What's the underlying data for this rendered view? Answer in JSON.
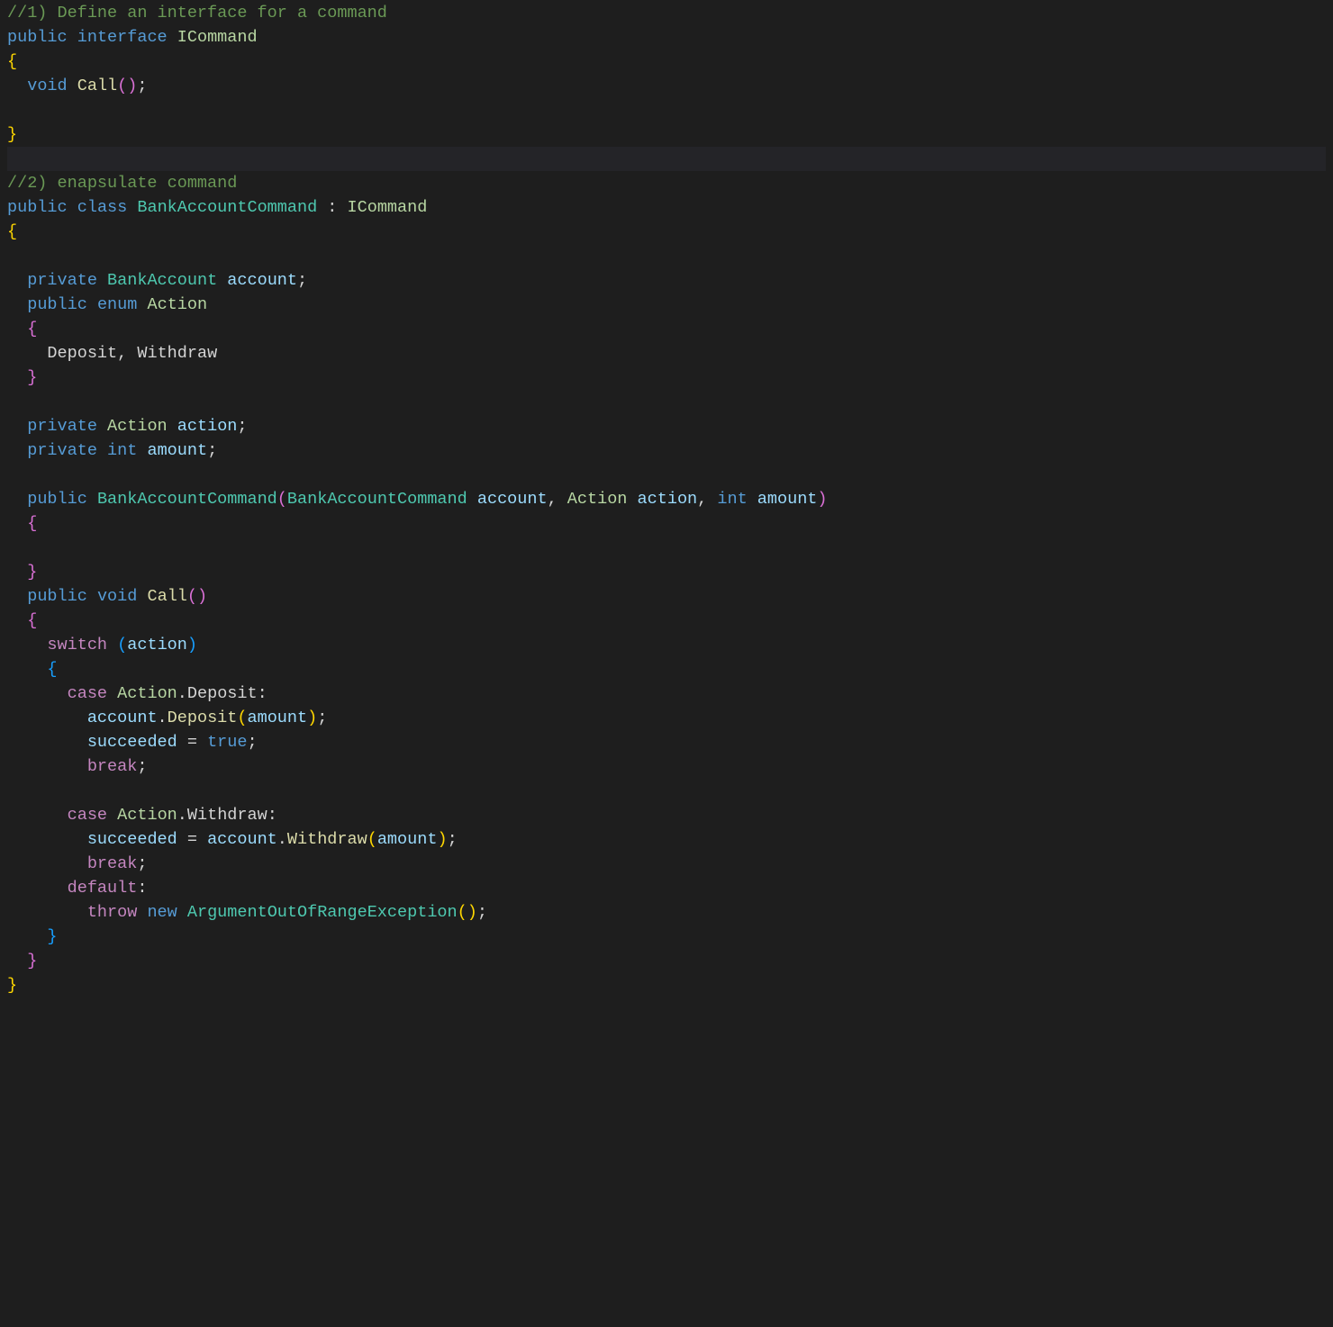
{
  "code": {
    "comment1": "//1) Define an interface for a command",
    "public": "public",
    "interface": "interface",
    "ICommand": "ICommand",
    "void": "void",
    "Call": "Call",
    "empty_parens": "()",
    "semi": ";",
    "open_brace": "{",
    "close_brace": "}",
    "comment2": "//2) enapsulate command",
    "class": "class",
    "BankAccountCommand": "BankAccountCommand",
    "colon_impl": " : ",
    "private": "private",
    "BankAccount": "BankAccount",
    "account": "account",
    "enum": "enum",
    "Action": "Action",
    "Deposit": "Deposit",
    "comma_sp": ", ",
    "Withdraw": "Withdraw",
    "action_field": "action",
    "int": "int",
    "amount": "amount",
    "open_paren": "(",
    "close_paren": ")",
    "switch": "switch",
    "case": "case",
    "dot": ".",
    "colon": ":",
    "succeeded": "succeeded",
    "equals": " = ",
    "true": "true",
    "break": "break",
    "default": "default",
    "throw": "throw",
    "new": "new",
    "ArgumentOutOfRangeException": "ArgumentOutOfRangeException"
  }
}
